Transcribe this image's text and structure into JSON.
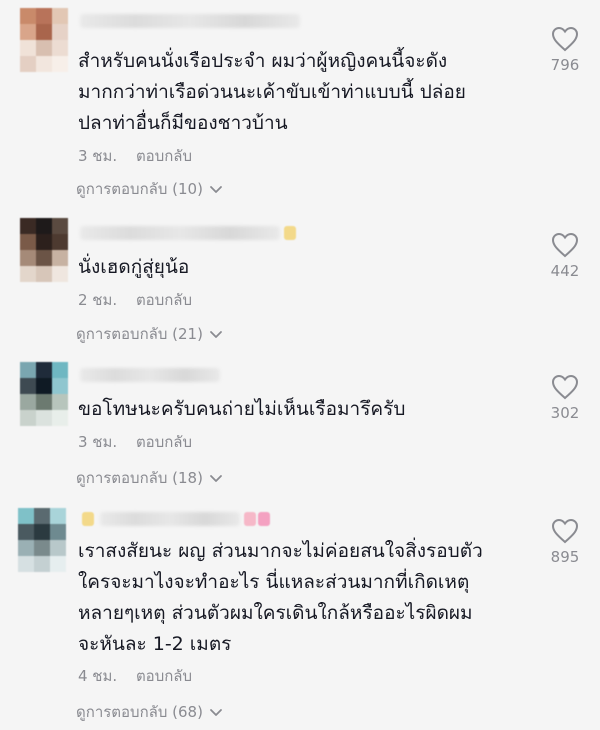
{
  "comments": [
    {
      "text": "สำหรับคนนั่งเรือประจำ ผมว่าผู้หญิงคนนี้จะดัง\nมากกว่าท่าเรือด่วนนะเค้าขับเข้าท่าแบบนี้ ปล่อย\nปลาท่าอื่นก็มีของชาวบ้าน",
      "time": "3 ชม.",
      "reply_label": "ตอบกลับ",
      "view_replies": "ดูการตอบกลับ (10)",
      "likes": "796",
      "avatar_colors": [
        "#c98a6a",
        "#b8735a",
        "#e2c7b4",
        "#d9a58a",
        "#a9654c",
        "#e6d2c7",
        "#f0e2d8",
        "#d8bfb0",
        "#ecdcd2",
        "#e4cfc3",
        "#f2e6de",
        "#f7efe9"
      ]
    },
    {
      "text": "นั่งเฮดกู่สู่ยุน้อ",
      "time": "2 ชม.",
      "reply_label": "ตอบกลับ",
      "view_replies": "ดูการตอบกลับ (21)",
      "likes": "442",
      "avatar_colors": [
        "#3a2a24",
        "#1e1a1a",
        "#5a4a40",
        "#7a5a48",
        "#2c201c",
        "#4d3a30",
        "#a58a78",
        "#6b5446",
        "#c7b2a2",
        "#e3d6cb",
        "#d7c6b9",
        "#efe6df"
      ]
    },
    {
      "text": "ขอโทษนะครับคนถ่ายไม่เห็นเรือมารึครับ",
      "time": "3 ชม.",
      "reply_label": "ตอบกลับ",
      "view_replies": "ดูการตอบกลับ (18)",
      "likes": "302",
      "avatar_colors": [
        "#7aa6b0",
        "#1f2b3a",
        "#6fb7c2",
        "#3e4a52",
        "#0f1a24",
        "#8fc6cf",
        "#9aa8a0",
        "#6c7a70",
        "#b7c5bc",
        "#c9d2cc",
        "#dbe2de",
        "#e8eeea"
      ]
    },
    {
      "text": "เราสงสัยนะ ผญ ส่วนมากจะไม่ค่อยสนใจสิ่งรอบตัว\nใครจะมาไงจะทำอะไร นี่แหละส่วนมากที่เกิดเหตุ\nหลายๆเหตุ ส่วนตัวผมใครเดินใกล้หรืออะไรผิดผม\nจะหันละ 1-2 เมตร",
      "time": "4 ชม.",
      "reply_label": "ตอบกลับ",
      "view_replies": "ดูการตอบกลับ (68)",
      "likes": "895",
      "avatar_colors": [
        "#7fc1c8",
        "#5a6a70",
        "#a9d4d9",
        "#4a5a60",
        "#2b3a40",
        "#6e8a90",
        "#9ab0b4",
        "#7a8a8c",
        "#b8c8ca",
        "#d6e0e2",
        "#c4d0d2",
        "#e6eeef"
      ]
    }
  ],
  "icons": {
    "like": "heart-outline-icon",
    "expand": "chevron-down-icon"
  },
  "colors": {
    "background": "#f5f5f5",
    "text": "#161823",
    "muted": "#8a8b91",
    "name_accent_1": "#f3d98a",
    "name_accent_2": "#f6b8c8",
    "name_accent_3": "#f4a1c1"
  }
}
